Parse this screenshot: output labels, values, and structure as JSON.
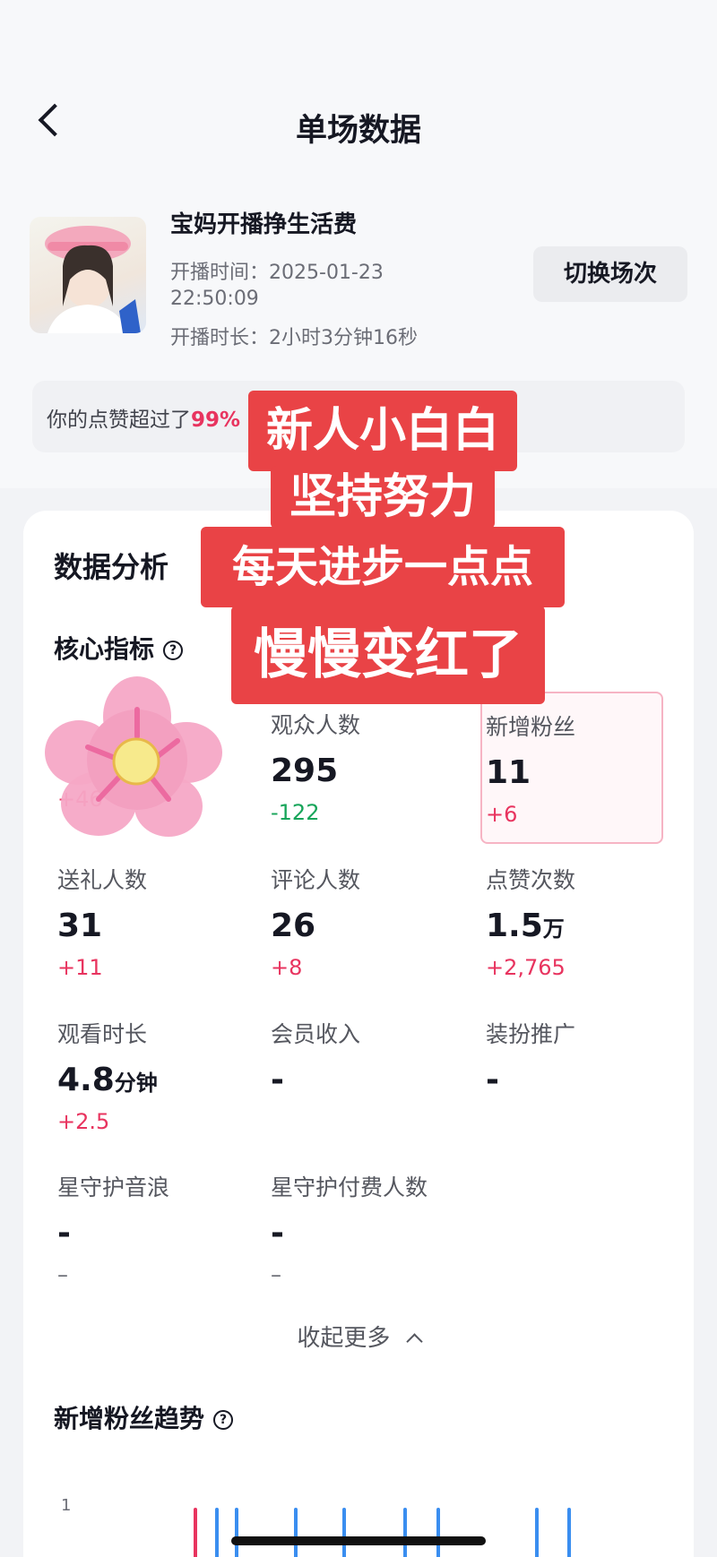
{
  "nav": {
    "title": "单场数据"
  },
  "stream": {
    "name": "宝妈开播挣生活费",
    "start_label": "开播时间：",
    "start_date": "2025-01-23",
    "start_time": "22:50:09",
    "duration_label": "开播时长：",
    "duration": "2小时3分钟16秒",
    "switch_label": "切换场次"
  },
  "likes_banner": {
    "prefix": "你的点赞超过了",
    "percent": "99%"
  },
  "analysis": {
    "title": "数据分析",
    "core_title": "核心指标",
    "help": "?",
    "metrics": [
      {
        "label": "",
        "value": "",
        "change": "+46"
      },
      {
        "label": "观众人数",
        "value": "295",
        "change": "-122"
      },
      {
        "label": "新增粉丝",
        "value": "11",
        "change": "+6"
      },
      {
        "label": "送礼人数",
        "value": "31",
        "change": "+11"
      },
      {
        "label": "评论人数",
        "value": "26",
        "change": "+8"
      },
      {
        "label": "点赞次数",
        "value": "1.5",
        "unit": "万",
        "change": "+2,765"
      },
      {
        "label": "观看时长",
        "value": "4.8",
        "unit": "分钟",
        "change": "+2.5"
      },
      {
        "label": "会员收入",
        "value": "-",
        "change": ""
      },
      {
        "label": "装扮推广",
        "value": "-",
        "change": ""
      },
      {
        "label": "星守护音浪",
        "value": "-",
        "change": "–"
      },
      {
        "label": "星守护付费人数",
        "value": "-",
        "change": "–"
      }
    ],
    "collapse_label": "收起更多",
    "trend_title": "新增粉丝趋势",
    "trend_y_tick": "1"
  },
  "overlay": {
    "lines": [
      "新人小白白",
      "坚持努力",
      "每天进步一点点",
      "慢慢变红了"
    ]
  },
  "colors": {
    "accent": "#e8345f",
    "positive": "#e8345f",
    "negative": "#17a55a",
    "overlay_bg": "#e94346"
  }
}
